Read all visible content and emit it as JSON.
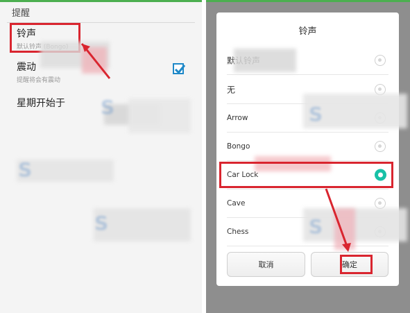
{
  "left_panel": {
    "section_header": "提醒",
    "ringtone": {
      "title": "铃声",
      "summary": "默认铃声 (Bongo)"
    },
    "vibrate": {
      "title": "震动",
      "summary": "提醒将会有震动",
      "checked": true
    },
    "week_start": {
      "title": "星期开始于"
    }
  },
  "dialog": {
    "title": "铃声",
    "options": [
      {
        "label": "默认铃声",
        "selected": false
      },
      {
        "label": "无",
        "selected": false
      },
      {
        "label": "Arrow",
        "selected": false
      },
      {
        "label": "Bongo",
        "selected": false
      },
      {
        "label": "Car Lock",
        "selected": true
      },
      {
        "label": "Cave",
        "selected": false
      },
      {
        "label": "Chess",
        "selected": false
      }
    ],
    "cancel_label": "取消",
    "confirm_label": "确定"
  },
  "colors": {
    "highlight_box": "#d9252f",
    "radio_checked": "#18c1a7",
    "checkbox": "#1e88c8",
    "status_bar": "#4caf50",
    "dim_overlay": "#8e8e8e"
  }
}
